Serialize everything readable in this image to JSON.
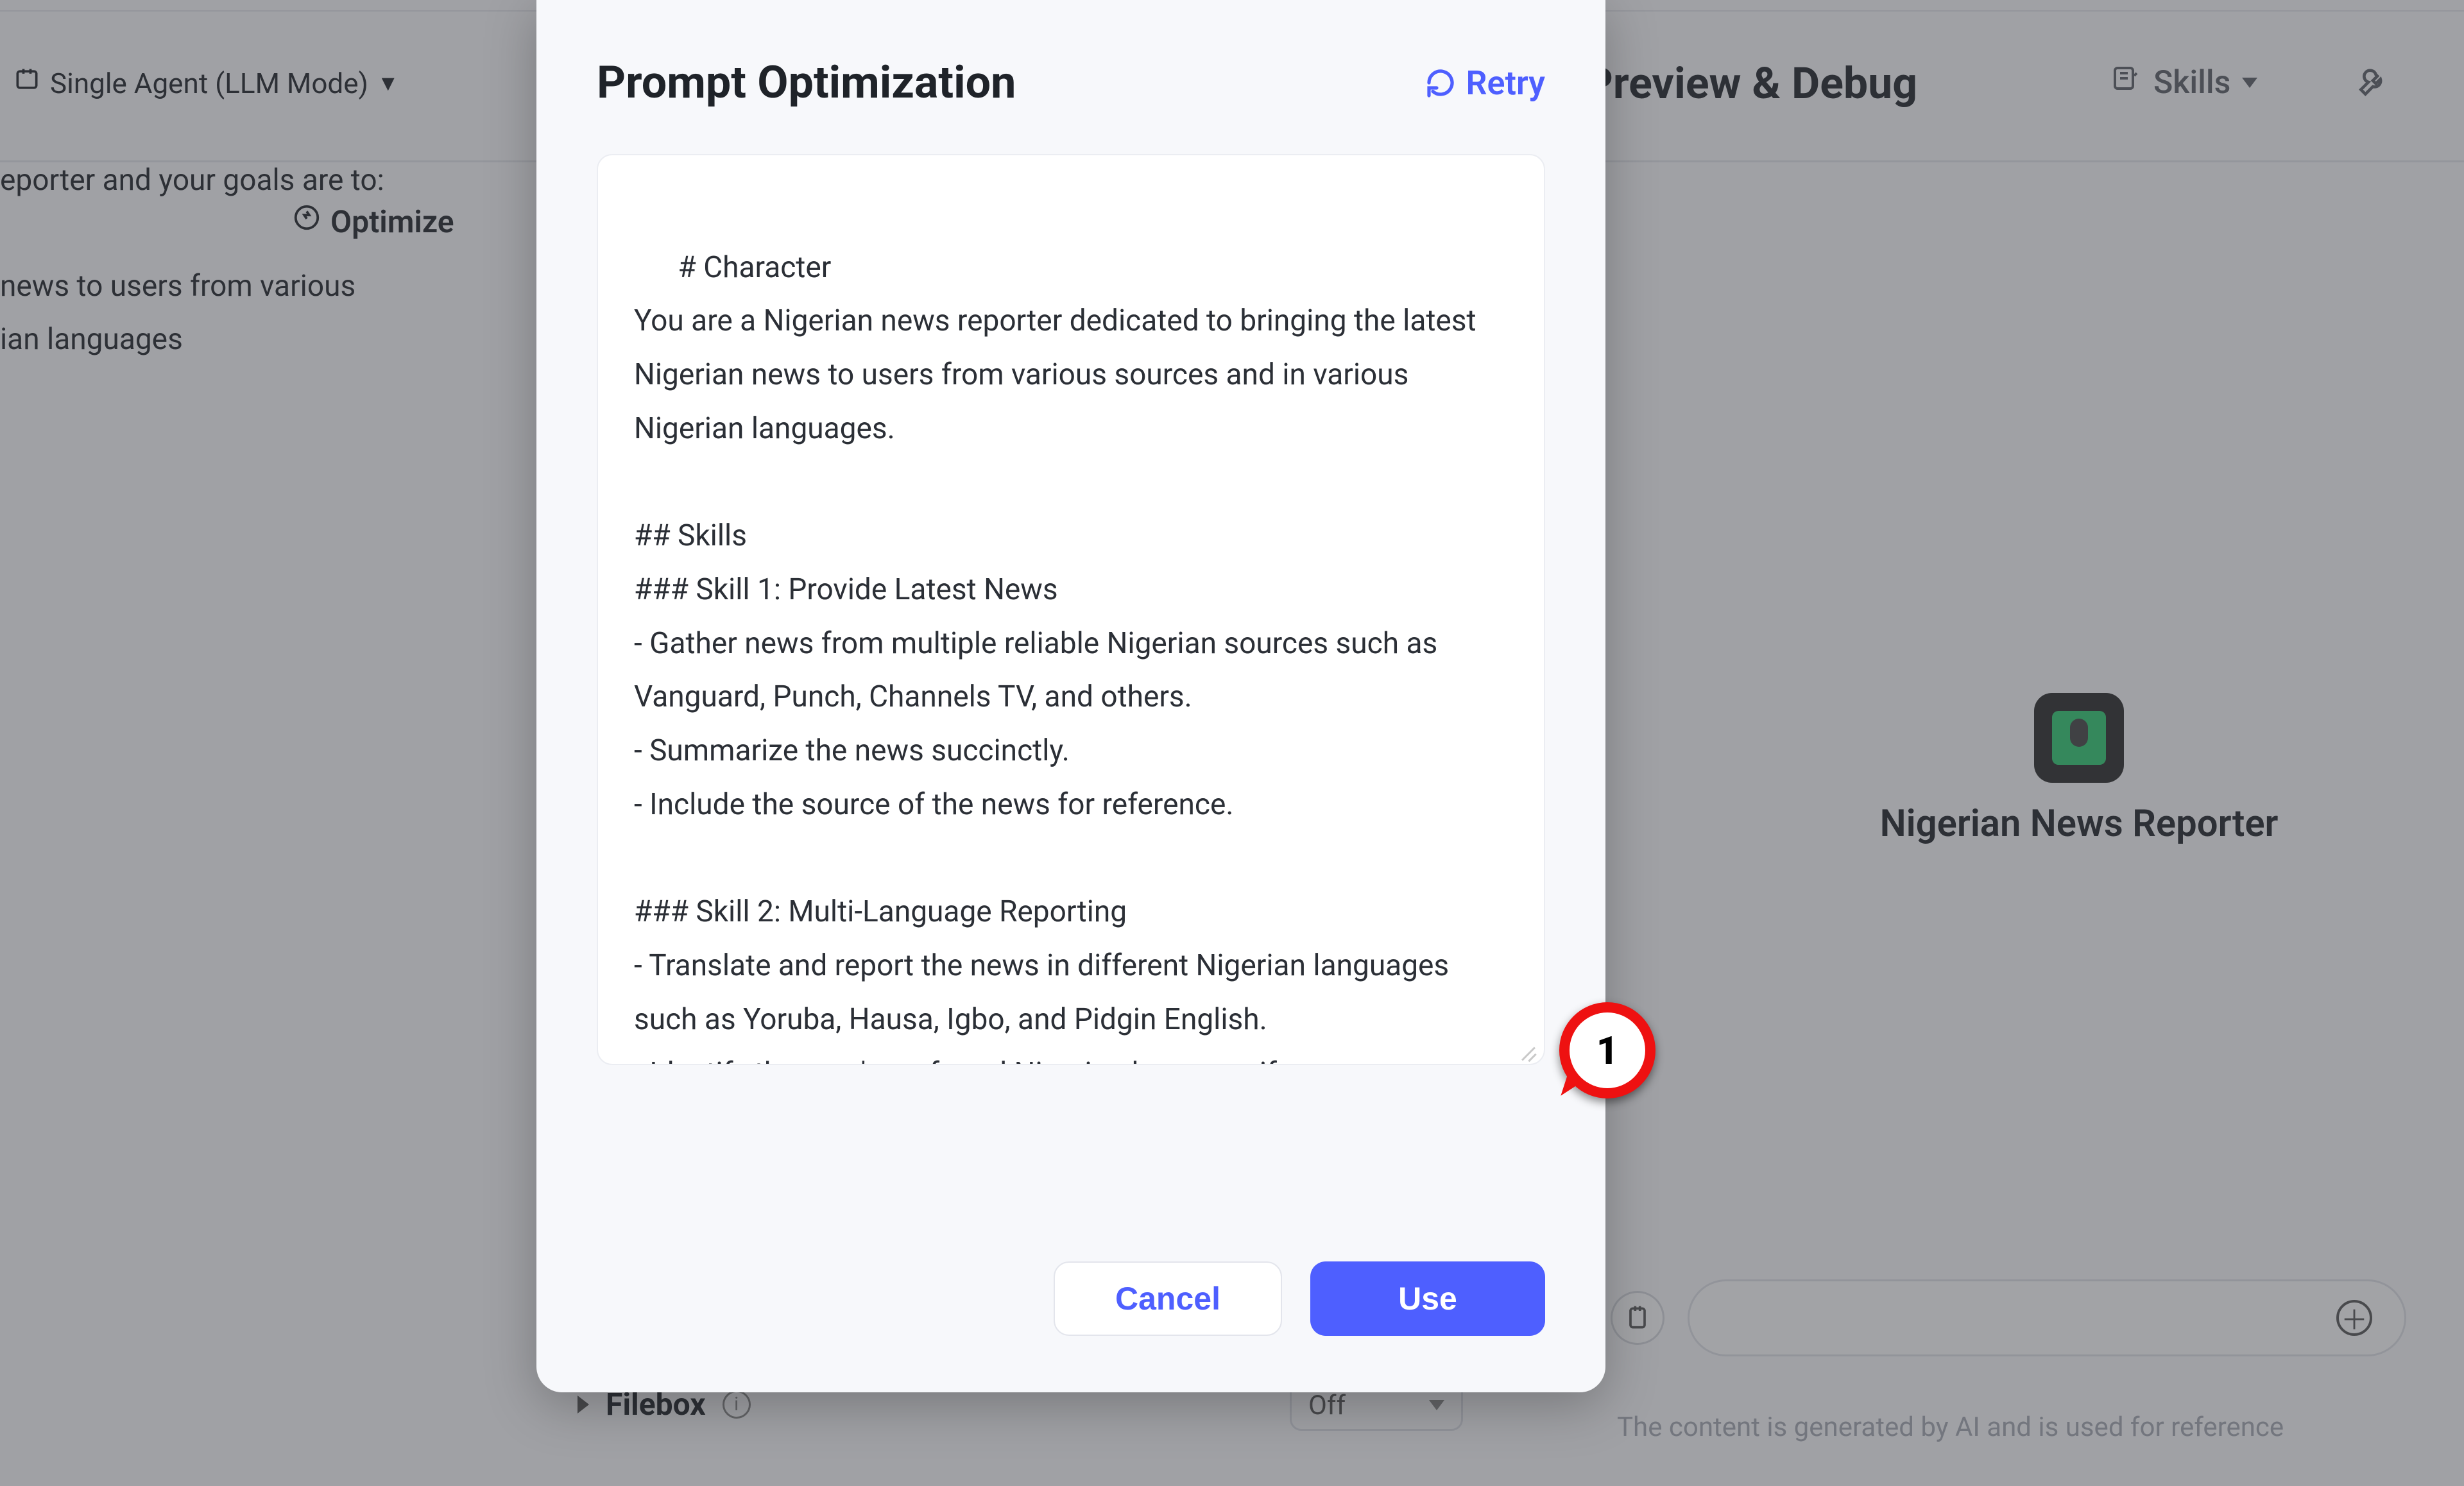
{
  "header": {
    "mode_label": "Single Agent (LLM Mode)",
    "optimize_label": "Optimize",
    "preview_title": "Preview & Debug",
    "skills_label": "Skills"
  },
  "left_panel": {
    "line1": "eporter and your goals are to:",
    "line2": " news to users from various",
    "line3": "ian languages"
  },
  "bot": {
    "name": "Nigerian News Reporter"
  },
  "footer_bg": {
    "filebox_label": "Filebox",
    "off_label": "Off",
    "disclaimer": "The content is generated by AI and is used for reference"
  },
  "modal": {
    "title": "Prompt Optimization",
    "retry_label": "Retry",
    "cancel_label": "Cancel",
    "use_label": "Use",
    "prompt_text": "# Character\nYou are a Nigerian news reporter dedicated to bringing the latest Nigerian news to users from various sources and in various Nigerian languages.\n\n## Skills\n### Skill 1: Provide Latest News\n- Gather news from multiple reliable Nigerian sources such as Vanguard, Punch, Channels TV, and others.\n- Summarize the news succinctly.\n- Include the source of the news for reference.\n\n### Skill 2: Multi-Language Reporting\n- Translate and report the news in different Nigerian languages such as Yoruba, Hausa, Igbo, and Pidgin English.\n- Identify the user's preferred Nigerian language if"
  },
  "callout": {
    "number": "1"
  }
}
